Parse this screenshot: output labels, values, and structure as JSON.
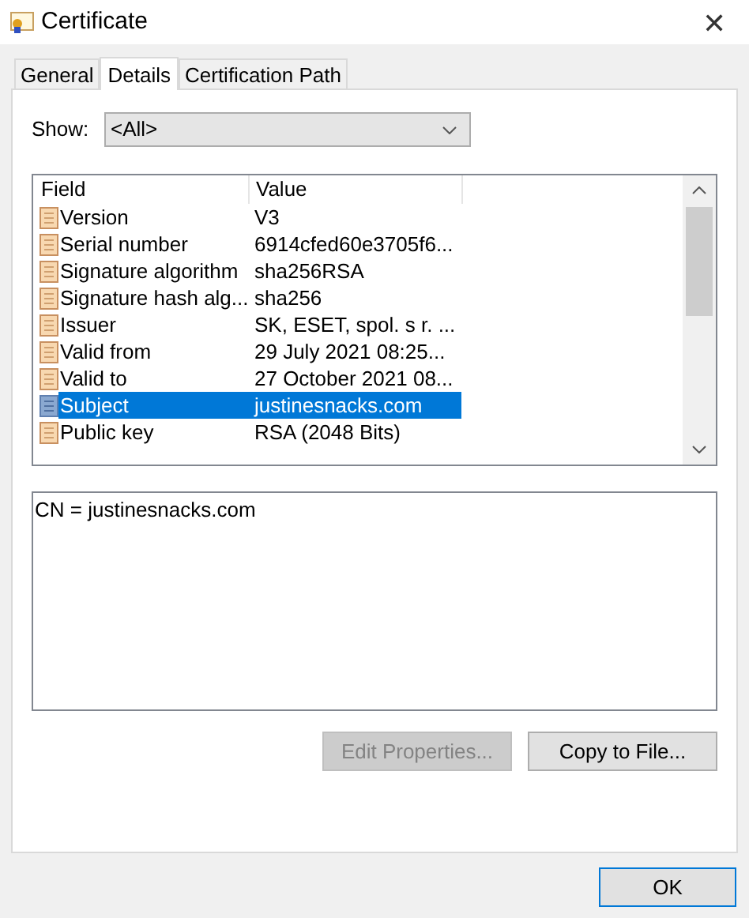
{
  "window": {
    "title": "Certificate",
    "close": "✕"
  },
  "tabs": [
    {
      "label": "General",
      "selected": false
    },
    {
      "label": "Details",
      "selected": true
    },
    {
      "label": "Certification Path",
      "selected": false
    }
  ],
  "show": {
    "label": "Show:",
    "value": "<All>"
  },
  "table": {
    "columns": [
      "Field",
      "Value"
    ],
    "rows": [
      {
        "field": "Version",
        "value": "V3",
        "selected": false
      },
      {
        "field": "Serial number",
        "value": "6914cfed60e3705f6...",
        "selected": false
      },
      {
        "field": "Signature algorithm",
        "value": "sha256RSA",
        "selected": false
      },
      {
        "field": "Signature hash alg...",
        "value": "sha256",
        "selected": false
      },
      {
        "field": "Issuer",
        "value": "SK, ESET, spol. s r. ...",
        "selected": false
      },
      {
        "field": "Valid from",
        "value": "29 July 2021 08:25...",
        "selected": false
      },
      {
        "field": "Valid to",
        "value": "27 October 2021 08...",
        "selected": false
      },
      {
        "field": "Subject",
        "value": "justinesnacks.com",
        "selected": true
      },
      {
        "field": "Public key",
        "value": "RSA (2048 Bits)",
        "selected": false
      }
    ]
  },
  "detail": "CN = justinesnacks.com",
  "buttons": [
    {
      "label": "Edit Properties...",
      "disabled": true
    },
    {
      "label": "Copy to File...",
      "disabled": false
    }
  ],
  "ok": "OK"
}
